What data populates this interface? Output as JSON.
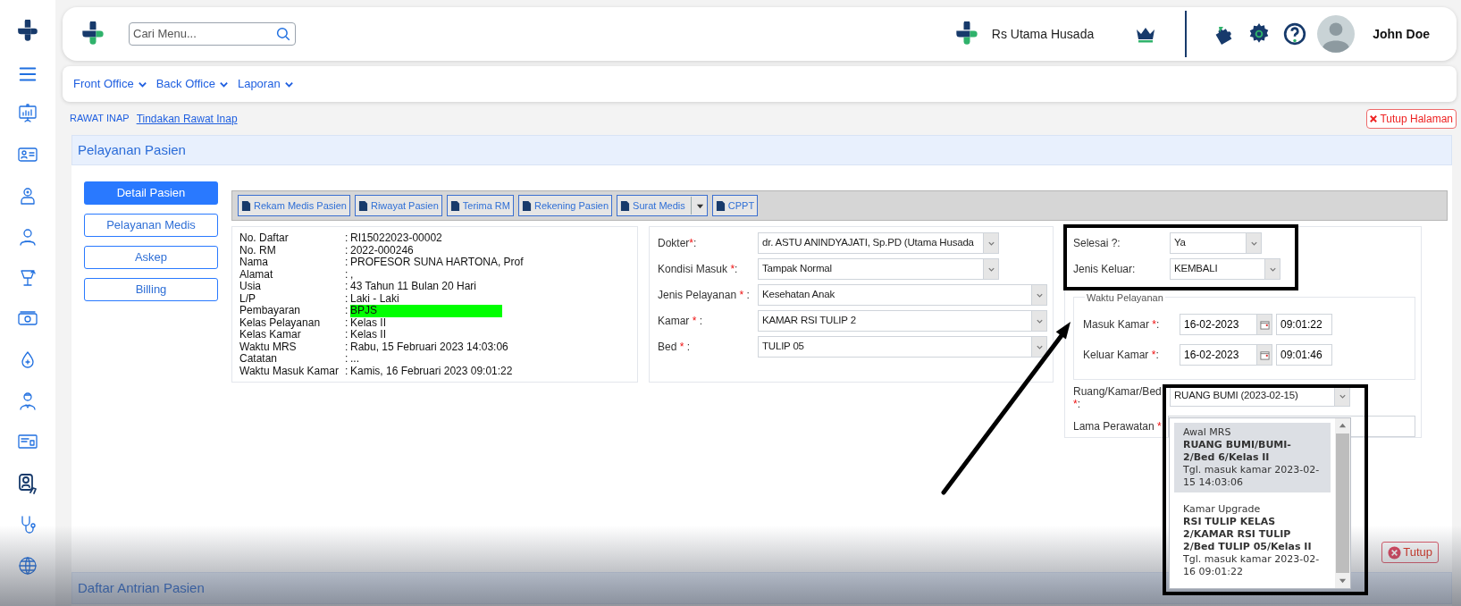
{
  "sidebar": {
    "items": [
      {
        "selected": false
      },
      {
        "selected": false
      },
      {
        "selected": false
      },
      {
        "selected": false
      },
      {
        "selected": false
      },
      {
        "selected": false
      },
      {
        "selected": false
      },
      {
        "selected": false
      },
      {
        "selected": false
      },
      {
        "selected": true
      },
      {
        "selected": false
      },
      {
        "selected": false
      }
    ]
  },
  "header": {
    "search": {
      "placeholder": "Cari Menu..."
    },
    "hospital_name": "Rs Utama Husada",
    "user_name": "John Doe"
  },
  "nav": [
    {
      "label": "Front Office"
    },
    {
      "label": "Back Office"
    },
    {
      "label": "Laporan"
    }
  ],
  "breadcrumb": {
    "section": "RAWAT INAP",
    "page": "Tindakan Rawat Inap"
  },
  "close_page_button": "Tutup Halaman",
  "panel_title": "Pelayanan Pasien",
  "side_tabs": [
    {
      "label": "Detail Pasien",
      "selected": true
    },
    {
      "label": "Pelayanan Medis",
      "selected": false
    },
    {
      "label": "Askep",
      "selected": false
    },
    {
      "label": "Billing",
      "selected": false
    }
  ],
  "toolbar": [
    {
      "label": "Rekam Medis Pasien",
      "kind": "button"
    },
    {
      "label": "Riwayat Pasien",
      "kind": "button"
    },
    {
      "label": "Terima RM",
      "kind": "button"
    },
    {
      "label": "Rekening Pasien",
      "kind": "button"
    },
    {
      "label": "Surat Medis",
      "kind": "dropdown"
    },
    {
      "label": "CPPT",
      "kind": "button"
    }
  ],
  "patient_info": [
    {
      "label": "No. Daftar",
      "sep": ":",
      "value": "RI15022023-00002",
      "highlighted": false
    },
    {
      "label": "No. RM",
      "sep": ":",
      "value": "2022-000246",
      "highlighted": false
    },
    {
      "label": "Nama",
      "sep": ":",
      "value": "PROFESOR SUNA HARTONA, Prof",
      "highlighted": false
    },
    {
      "label": "Alamat",
      "sep": ":",
      "value": ",",
      "highlighted": false
    },
    {
      "label": "Usia",
      "sep": ":",
      "value": "43 Tahun 11 Bulan 20 Hari",
      "highlighted": false
    },
    {
      "label": "L/P",
      "sep": ":",
      "value": "Laki - Laki",
      "highlighted": false
    },
    {
      "label": "Pembayaran",
      "sep": ":",
      "value": "BPJS",
      "highlighted": true
    },
    {
      "label": "Kelas Pelayanan",
      "sep": ":",
      "value": "Kelas II",
      "highlighted": false
    },
    {
      "label": "Kelas Kamar",
      "sep": ":",
      "value": "Kelas II",
      "highlighted": false
    },
    {
      "label": "Waktu MRS",
      "sep": ":",
      "value": "Rabu, 15 Februari 2023 14:03:06",
      "highlighted": false
    },
    {
      "label": "Catatan",
      "sep": ":",
      "value": "...",
      "highlighted": false
    },
    {
      "label": "Waktu Masuk Kamar",
      "sep": ":",
      "value": "Kamis, 16 Februari 2023 09:01:22",
      "highlighted": false
    }
  ],
  "service_form": [
    {
      "label": "Dokter",
      "mark": "*",
      "tail": ":",
      "value": "dr. ASTU ANINDYAJATI, Sp.PD (Utama Husada",
      "wide": false
    },
    {
      "label": "Kondisi Masuk ",
      "mark": "*",
      "tail": ":",
      "value": "Tampak Normal",
      "wide": false
    },
    {
      "label": "Jenis Pelayanan ",
      "mark": "*",
      "tail": " :",
      "value": "Kesehatan Anak",
      "wide": true
    },
    {
      "label": "Kamar ",
      "mark": "*",
      "tail": " :",
      "value": "KAMAR RSI TULIP 2",
      "wide": true
    },
    {
      "label": "Bed ",
      "mark": "*",
      "tail": " :",
      "value": "TULIP 05",
      "wide": true
    }
  ],
  "discharge": [
    {
      "label": "Selesai ?:",
      "value": "Ya"
    },
    {
      "label": "Jenis Keluar:",
      "value": "KEMBALI"
    }
  ],
  "service_time": {
    "title": "Waktu Pelayanan",
    "rows": [
      {
        "label": "Masuk Kamar ",
        "mark": "*",
        "tail": ":",
        "date": "16-02-2023",
        "time": "09:01:22"
      },
      {
        "label": "Keluar Kamar ",
        "mark": "*",
        "tail": ":",
        "date": "16-02-2023",
        "time": "09:01:46"
      }
    ]
  },
  "room_field": {
    "label": "Ruang/Kamar/Bed",
    "mark": "*",
    "tail": ":",
    "value": "RUANG BUMI (2023-02-15)",
    "options": [
      {
        "caption": "Awal MRS",
        "title": "RUANG BUMI/BUMI-2/Bed 6/Kelas II",
        "date": "Tgl. masuk kamar 2023-02-15 14:03:06",
        "selected": true
      },
      {
        "caption": "Kamar Upgrade",
        "title": "RSI TULIP KELAS 2/KAMAR RSI TULIP 2/Bed TULIP 05/Kelas II",
        "date": "Tgl. masuk kamar 2023-02-16 09:01:22",
        "selected": false
      }
    ]
  },
  "length_of_stay": {
    "label": "Lama Perawatan ",
    "mark": "*"
  },
  "close_button": "Tutup",
  "queue_title": "Daftar Antrian Pasien"
}
